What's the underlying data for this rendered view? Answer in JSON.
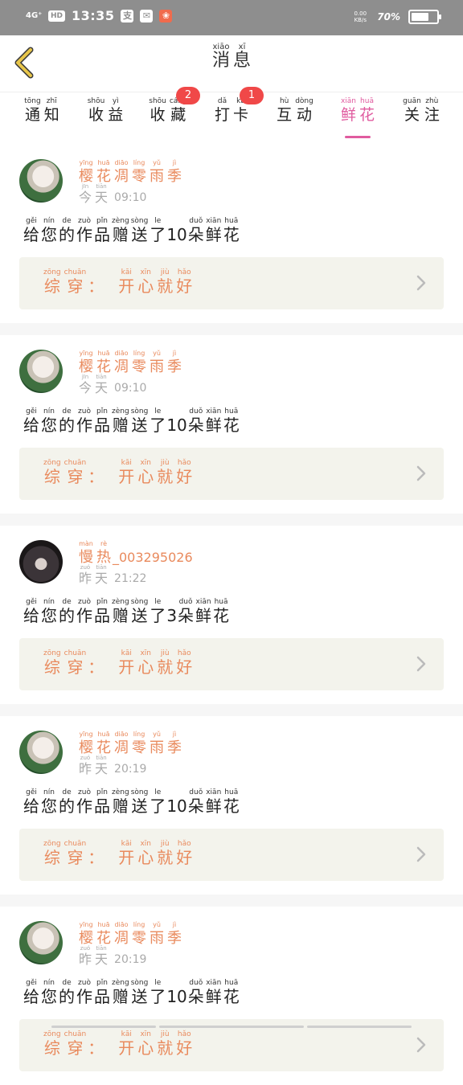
{
  "status_bar": {
    "signal": "4G⁺",
    "hd": "HD",
    "time": "13:35",
    "speed": "0.00 KB/s",
    "battery": "70%",
    "battery_level": 0.7
  },
  "header": {
    "title": [
      {
        "p": "xiāo",
        "h": "消"
      },
      {
        "p": "xī",
        "h": "息"
      }
    ]
  },
  "tabs": [
    {
      "id": "notify",
      "chars": [
        {
          "p": "tōng",
          "h": "通"
        },
        {
          "p": "zhī",
          "h": "知"
        }
      ]
    },
    {
      "id": "income",
      "chars": [
        {
          "p": "shōu",
          "h": "收"
        },
        {
          "p": "yì",
          "h": "益"
        }
      ]
    },
    {
      "id": "collect",
      "chars": [
        {
          "p": "shōu",
          "h": "收"
        },
        {
          "p": "cáng",
          "h": "藏"
        }
      ],
      "badge": "2"
    },
    {
      "id": "checkin",
      "chars": [
        {
          "p": "dǎ",
          "h": "打"
        },
        {
          "p": "kǎ",
          "h": "卡"
        }
      ],
      "badge": "1"
    },
    {
      "id": "interact",
      "chars": [
        {
          "p": "hù",
          "h": "互"
        },
        {
          "p": "dòng",
          "h": "动"
        }
      ]
    },
    {
      "id": "flowers",
      "chars": [
        {
          "p": "xiān",
          "h": "鲜"
        },
        {
          "p": "huā",
          "h": "花"
        }
      ],
      "active": true
    },
    {
      "id": "follow",
      "chars": [
        {
          "p": "guān",
          "h": "关"
        },
        {
          "p": "zhù",
          "h": "注"
        }
      ]
    }
  ],
  "notifications": [
    {
      "avatar": "a",
      "name": [
        {
          "p": "yīng",
          "h": "樱"
        },
        {
          "p": "huā",
          "h": "花"
        },
        {
          "p": "diāo",
          "h": "凋"
        },
        {
          "p": "líng",
          "h": "零"
        },
        {
          "p": "yǔ",
          "h": "雨"
        },
        {
          "p": "jì",
          "h": "季"
        }
      ],
      "name_tail": "",
      "day": [
        {
          "p": "jīn",
          "h": "今"
        },
        {
          "p": "tiān",
          "h": "天"
        }
      ],
      "time": "09:10",
      "count": "10",
      "work": [
        {
          "p": "kāi",
          "h": "开"
        },
        {
          "p": "xīn",
          "h": "心"
        },
        {
          "p": "jiù",
          "h": "就"
        },
        {
          "p": "hǎo",
          "h": "好"
        }
      ]
    },
    {
      "avatar": "a",
      "name": [
        {
          "p": "yīng",
          "h": "樱"
        },
        {
          "p": "huā",
          "h": "花"
        },
        {
          "p": "diāo",
          "h": "凋"
        },
        {
          "p": "líng",
          "h": "零"
        },
        {
          "p": "yǔ",
          "h": "雨"
        },
        {
          "p": "jì",
          "h": "季"
        }
      ],
      "name_tail": "",
      "day": [
        {
          "p": "jīn",
          "h": "今"
        },
        {
          "p": "tiān",
          "h": "天"
        }
      ],
      "time": "09:10",
      "count": "10",
      "work": [
        {
          "p": "kāi",
          "h": "开"
        },
        {
          "p": "xīn",
          "h": "心"
        },
        {
          "p": "jiù",
          "h": "就"
        },
        {
          "p": "hǎo",
          "h": "好"
        }
      ]
    },
    {
      "avatar": "b",
      "name": [
        {
          "p": "màn",
          "h": "慢"
        },
        {
          "p": "rè",
          "h": "热"
        }
      ],
      "name_tail": "_003295026",
      "day": [
        {
          "p": "zuó",
          "h": "昨"
        },
        {
          "p": "tiān",
          "h": "天"
        }
      ],
      "time": "21:22",
      "count": "3",
      "work": [
        {
          "p": "kāi",
          "h": "开"
        },
        {
          "p": "xīn",
          "h": "心"
        },
        {
          "p": "jiù",
          "h": "就"
        },
        {
          "p": "hǎo",
          "h": "好"
        }
      ]
    },
    {
      "avatar": "a",
      "name": [
        {
          "p": "yīng",
          "h": "樱"
        },
        {
          "p": "huā",
          "h": "花"
        },
        {
          "p": "diāo",
          "h": "凋"
        },
        {
          "p": "líng",
          "h": "零"
        },
        {
          "p": "yǔ",
          "h": "雨"
        },
        {
          "p": "jì",
          "h": "季"
        }
      ],
      "name_tail": "",
      "day": [
        {
          "p": "zuó",
          "h": "昨"
        },
        {
          "p": "tiān",
          "h": "天"
        }
      ],
      "time": "20:19",
      "count": "10",
      "work": [
        {
          "p": "kāi",
          "h": "开"
        },
        {
          "p": "xīn",
          "h": "心"
        },
        {
          "p": "jiù",
          "h": "就"
        },
        {
          "p": "hǎo",
          "h": "好"
        }
      ]
    },
    {
      "avatar": "a",
      "name": [
        {
          "p": "yīng",
          "h": "樱"
        },
        {
          "p": "huā",
          "h": "花"
        },
        {
          "p": "diāo",
          "h": "凋"
        },
        {
          "p": "líng",
          "h": "零"
        },
        {
          "p": "yǔ",
          "h": "雨"
        },
        {
          "p": "jì",
          "h": "季"
        }
      ],
      "name_tail": "",
      "day": [
        {
          "p": "zuó",
          "h": "昨"
        },
        {
          "p": "tiān",
          "h": "天"
        }
      ],
      "time": "20:19",
      "count": "10",
      "work": [
        {
          "p": "kāi",
          "h": "开"
        },
        {
          "p": "xīn",
          "h": "心"
        },
        {
          "p": "jiù",
          "h": "就"
        },
        {
          "p": "hǎo",
          "h": "好"
        }
      ]
    }
  ],
  "message": {
    "pre": [
      {
        "p": "gěi",
        "h": "给"
      },
      {
        "p": "nín",
        "h": "您"
      },
      {
        "p": "de",
        "h": "的"
      },
      {
        "p": "zuò",
        "h": "作"
      },
      {
        "p": "pǐn",
        "h": "品"
      },
      {
        "p": "zèng",
        "h": "赠"
      },
      {
        "p": "sòng",
        "h": "送"
      },
      {
        "p": "le",
        "h": "了"
      }
    ],
    "post": [
      {
        "p": "duǒ",
        "h": "朵"
      },
      {
        "p": "xiān",
        "h": "鲜"
      },
      {
        "p": "huā",
        "h": "花"
      }
    ]
  },
  "work_label": [
    {
      "p": "zōng",
      "h": "综"
    },
    {
      "p": "chuān",
      "h": "穿"
    }
  ],
  "work_colon": "：",
  "colors": {
    "accent": "#e05b9f",
    "name": "#e98a5d",
    "badge": "#f04848"
  }
}
